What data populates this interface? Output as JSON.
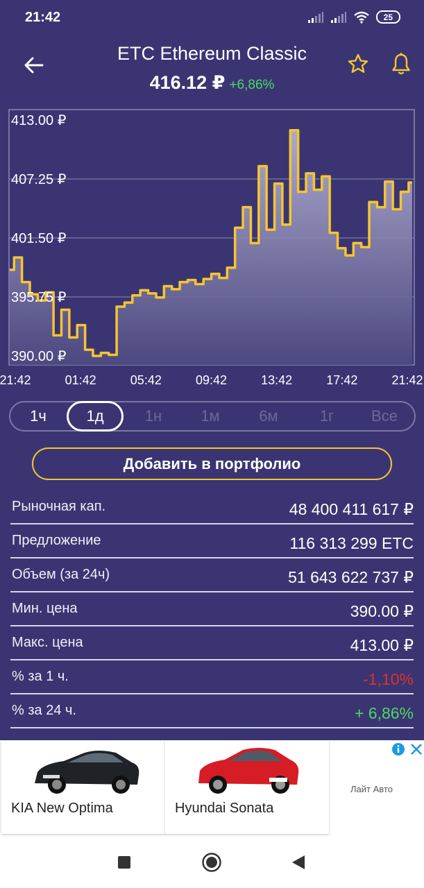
{
  "status": {
    "time": "21:42",
    "battery": "25"
  },
  "header": {
    "title": "ETC Ethereum Classic",
    "price": "416.12 ₽",
    "change": "+6,86%"
  },
  "chart_data": {
    "type": "line",
    "ylim": [
      390,
      413
    ],
    "y_ticks": [
      "413.00 ₽",
      "407.25 ₽",
      "401.50 ₽",
      "395.75 ₽",
      "390.00 ₽"
    ],
    "x_ticks": [
      "21:42",
      "01:42",
      "05:42",
      "09:42",
      "13:42",
      "17:42",
      "21:42"
    ],
    "series": [
      {
        "color": "#f6c531",
        "values": [
          398.4,
          399.6,
          397.2,
          396.0,
          395.4,
          396.2,
          392.0,
          394.5,
          391.8,
          393.0,
          390.6,
          390.0,
          390.3,
          390.1,
          394.8,
          395.2,
          395.9,
          396.4,
          396.1,
          395.7,
          396.8,
          396.5,
          397.2,
          397.4,
          397.0,
          397.5,
          398.0,
          397.6,
          398.6,
          402.5,
          404.5,
          401.0,
          408.5,
          402.3,
          406.8,
          402.8,
          412.0,
          406.0,
          407.8,
          406.2,
          407.5,
          402.0,
          400.5,
          399.8,
          401.0,
          400.6,
          405.0,
          404.5,
          407.0,
          404.3,
          406.0,
          406.9
        ]
      }
    ]
  },
  "periods": [
    {
      "label": "1ч",
      "state": "enabled"
    },
    {
      "label": "1д",
      "state": "selected"
    },
    {
      "label": "1н",
      "state": "disabled"
    },
    {
      "label": "1м",
      "state": "disabled"
    },
    {
      "label": "6м",
      "state": "disabled"
    },
    {
      "label": "1г",
      "state": "disabled"
    },
    {
      "label": "Все",
      "state": "disabled"
    }
  ],
  "portfolio_button": "Добавить в портфолио",
  "stats": [
    {
      "label": "Рыночная кап.",
      "value": "48 400 411 617 ₽",
      "tone": "normal"
    },
    {
      "label": "Предложение",
      "value": "116 313 299 ETC",
      "tone": "normal"
    },
    {
      "label": "Объем (за 24ч)",
      "value": "51 643 622 737 ₽",
      "tone": "normal"
    },
    {
      "label": "Мин. цена",
      "value": "390.00 ₽",
      "tone": "normal"
    },
    {
      "label": "Макс. цена",
      "value": "413.00 ₽",
      "tone": "normal"
    },
    {
      "label": "% за 1 ч.",
      "value": "-1,10%",
      "tone": "neg"
    },
    {
      "label": "% за 24 ч.",
      "value": "+ 6,86%",
      "tone": "pos"
    }
  ],
  "ad": {
    "cars": [
      "KIA New Optima",
      "Hyundai Sonata"
    ],
    "sponsor": "Лайт Авто"
  },
  "colors": {
    "background": "#3a3572",
    "accent": "#f6c531",
    "positive": "#4cd964",
    "negative": "#e0302a"
  }
}
